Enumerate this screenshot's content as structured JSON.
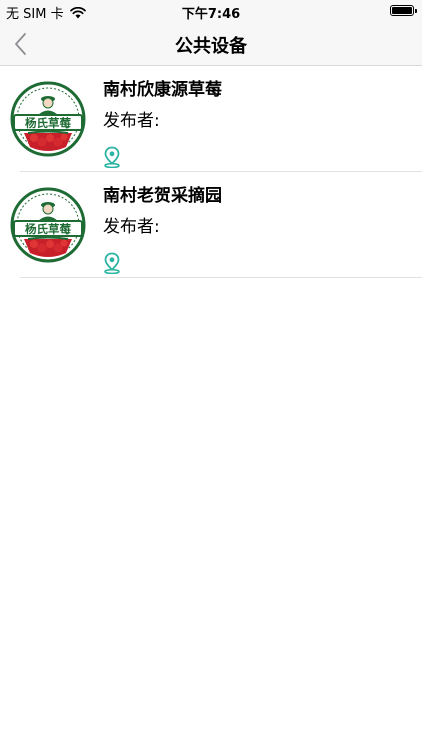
{
  "status_bar": {
    "carrier": "无 SIM 卡",
    "time": "下午7:46",
    "battery_level": 1.0
  },
  "nav": {
    "title": "公共设备",
    "back_icon": "chevron-left-icon"
  },
  "logo": {
    "text": "杨氏草莓",
    "colors": {
      "green": "#1e6b34",
      "red": "#c8202a"
    }
  },
  "items": [
    {
      "title": "南村欣康源草莓",
      "publisher": "发布者:",
      "location_icon": "location-pin-icon"
    },
    {
      "title": "南村老贺采摘园",
      "publisher": "发布者:",
      "location_icon": "location-pin-icon"
    }
  ],
  "colors": {
    "accent": "#2bb3a3",
    "separator": "#e2e2e2",
    "bar_background": "#f7f7f7"
  }
}
